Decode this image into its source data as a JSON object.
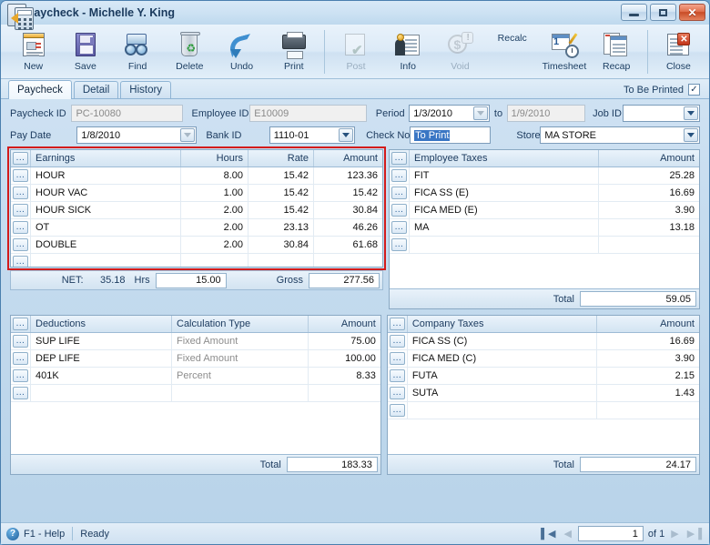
{
  "window": {
    "title": "Paycheck - Michelle Y. King",
    "app_icon": "play-circle-icon",
    "controls": {
      "minimize": "minimize-icon",
      "maximize": "maximize-icon",
      "close": "close-icon"
    }
  },
  "toolbar": [
    {
      "label": "New",
      "icon": "new-document-icon",
      "disabled": false
    },
    {
      "label": "Save",
      "icon": "floppy-disk-icon",
      "disabled": false
    },
    {
      "label": "Find",
      "icon": "binoculars-icon",
      "disabled": false
    },
    {
      "label": "Delete",
      "icon": "recycle-bin-icon",
      "disabled": false
    },
    {
      "label": "Undo",
      "icon": "undo-arrow-icon",
      "disabled": false
    },
    {
      "label": "Print",
      "icon": "printer-icon",
      "disabled": false
    },
    {
      "label": "Post",
      "icon": "post-checkmark-icon",
      "disabled": true
    },
    {
      "label": "Info",
      "icon": "person-info-icon",
      "disabled": false
    },
    {
      "label": "Void",
      "icon": "void-dollar-icon",
      "disabled": true
    },
    {
      "label": "Recalc",
      "icon": "calculator-icon",
      "disabled": false
    },
    {
      "label": "Timesheet",
      "icon": "timesheet-clock-icon",
      "disabled": false
    },
    {
      "label": "Recap",
      "icon": "recap-pages-icon",
      "disabled": false
    },
    {
      "label": "Close",
      "icon": "close-window-icon",
      "disabled": false
    }
  ],
  "tabs": [
    {
      "label": "Paycheck",
      "active": true
    },
    {
      "label": "Detail",
      "active": false
    },
    {
      "label": "History",
      "active": false
    }
  ],
  "to_be_printed": {
    "label": "To Be Printed",
    "checked": true,
    "check_glyph": "✓"
  },
  "form": {
    "paycheck_id": {
      "label": "Paycheck ID",
      "value": "PC-10080",
      "readonly": true
    },
    "employee_id": {
      "label": "Employee ID",
      "value": "E10009",
      "readonly": true
    },
    "period": {
      "label": "Period",
      "value": "1/3/2010",
      "dropdown_disabled": true
    },
    "period_to": {
      "label": "to",
      "value": "1/9/2010",
      "readonly": true
    },
    "job_id": {
      "label": "Job ID",
      "value": "",
      "dropdown": true
    },
    "pay_date": {
      "label": "Pay Date",
      "value": "1/8/2010",
      "dropdown": true,
      "dropdown_disabled": true
    },
    "bank_id": {
      "label": "Bank ID",
      "value": "1110-01",
      "dropdown": true
    },
    "check_no": {
      "label": "Check No",
      "value": "To Print",
      "selected": true
    },
    "store_id": {
      "label": "Store ID",
      "value": "MA STORE",
      "dropdown": true
    }
  },
  "earnings": {
    "headers": {
      "selector": "...",
      "name": "Earnings",
      "hours": "Hours",
      "rate": "Rate",
      "amount": "Amount"
    },
    "rows": [
      {
        "name": "HOUR",
        "hours": "8.00",
        "rate": "15.42",
        "amount": "123.36"
      },
      {
        "name": "HOUR VAC",
        "hours": "1.00",
        "rate": "15.42",
        "amount": "15.42"
      },
      {
        "name": "HOUR SICK",
        "hours": "2.00",
        "rate": "15.42",
        "amount": "30.84"
      },
      {
        "name": "OT",
        "hours": "2.00",
        "rate": "23.13",
        "amount": "46.26"
      },
      {
        "name": "DOUBLE",
        "hours": "2.00",
        "rate": "30.84",
        "amount": "61.68"
      },
      {
        "name": "",
        "hours": "",
        "rate": "",
        "amount": ""
      }
    ],
    "summary": {
      "net_label": "NET:",
      "net_value": "35.18",
      "hrs_label": "Hrs",
      "hrs_value": "15.00",
      "gross_label": "Gross",
      "gross_value": "277.56"
    },
    "highlight_color": "#d31b1b"
  },
  "employee_taxes": {
    "headers": {
      "selector": "...",
      "name": "Employee Taxes",
      "amount": "Amount"
    },
    "rows": [
      {
        "name": "FIT",
        "amount": "25.28"
      },
      {
        "name": "FICA SS (E)",
        "amount": "16.69"
      },
      {
        "name": "FICA MED (E)",
        "amount": "3.90"
      },
      {
        "name": "MA",
        "amount": "13.18"
      },
      {
        "name": "",
        "amount": ""
      }
    ],
    "total_label": "Total",
    "total_value": "59.05"
  },
  "deductions": {
    "headers": {
      "selector": "...",
      "name": "Deductions",
      "calc_type": "Calculation Type",
      "amount": "Amount"
    },
    "rows": [
      {
        "name": "SUP LIFE",
        "calc_type": "Fixed Amount",
        "amount": "75.00"
      },
      {
        "name": "DEP LIFE",
        "calc_type": "Fixed Amount",
        "amount": "100.00"
      },
      {
        "name": "401K",
        "calc_type": "Percent",
        "amount": "8.33"
      },
      {
        "name": "",
        "calc_type": "",
        "amount": ""
      }
    ],
    "total_label": "Total",
    "total_value": "183.33"
  },
  "company_taxes": {
    "headers": {
      "selector": "...",
      "name": "Company Taxes",
      "amount": "Amount"
    },
    "rows": [
      {
        "name": "FICA SS (C)",
        "amount": "16.69"
      },
      {
        "name": "FICA MED (C)",
        "amount": "3.90"
      },
      {
        "name": "FUTA",
        "amount": "2.15"
      },
      {
        "name": "SUTA",
        "amount": "1.43"
      },
      {
        "name": "",
        "amount": ""
      }
    ],
    "total_label": "Total",
    "total_value": "24.17"
  },
  "statusbar": {
    "help_icon": "question-mark-icon",
    "help_label": "F1 - Help",
    "status": "Ready",
    "nav": {
      "first": "▌◀",
      "prev": "◀",
      "page": "1",
      "of_label": "of 1",
      "next": "▶",
      "last": "▶▐"
    }
  }
}
